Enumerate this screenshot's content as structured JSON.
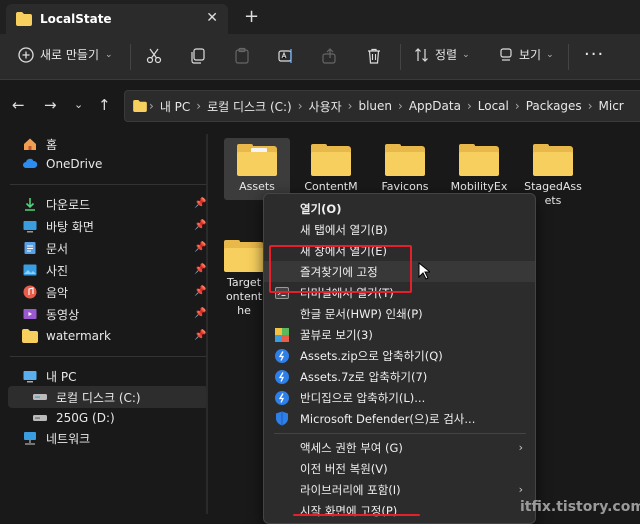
{
  "tab": {
    "title": "LocalState",
    "close": "✕",
    "new_tab": "+"
  },
  "toolbar": {
    "new_label": "새로 만들기",
    "sort_label": "정렬",
    "view_label": "보기",
    "more_label": "···"
  },
  "address": {
    "crumbs": [
      "내 PC",
      "로컬 디스크 (C:)",
      "사용자",
      "bluen",
      "AppData",
      "Local",
      "Packages",
      "Micr"
    ]
  },
  "sidebar": {
    "items": [
      {
        "label": "홈",
        "icon": "home-icon"
      },
      {
        "label": "OneDrive",
        "icon": "cloud-icon"
      },
      {
        "label": "다운로드",
        "icon": "download-icon"
      },
      {
        "label": "바탕 화면",
        "icon": "desktop-icon"
      },
      {
        "label": "문서",
        "icon": "document-icon"
      },
      {
        "label": "사진",
        "icon": "pictures-icon"
      },
      {
        "label": "음악",
        "icon": "music-icon"
      },
      {
        "label": "동영상",
        "icon": "video-icon"
      },
      {
        "label": "watermark",
        "icon": "folder-icon"
      },
      {
        "label": "내 PC",
        "icon": "pc-icon"
      },
      {
        "label": "로컬 디스크 (C:)",
        "icon": "drive-icon"
      },
      {
        "label": "250G (D:)",
        "icon": "drive-icon"
      },
      {
        "label": "네트워크",
        "icon": "network-icon"
      }
    ]
  },
  "folders": [
    {
      "name": "Assets"
    },
    {
      "name": "ContentM"
    },
    {
      "name": "Favicons"
    },
    {
      "name": "MobilityEx"
    },
    {
      "name": "StagedAss",
      "name2": "ets"
    },
    {
      "name": "Target",
      "name2": "ontent",
      "name3": "he"
    }
  ],
  "menu": {
    "items": [
      {
        "label": "열기(O)"
      },
      {
        "label": "새 탭에서 열기(B)"
      },
      {
        "label": "새 창에서 열기(E)"
      },
      {
        "label": "즐겨찾기에 고정"
      },
      {
        "label": "터미널에서 열기(T)"
      },
      {
        "label": "한글 문서(HWP) 인쇄(P)"
      },
      {
        "label": "꿀뷰로 보기(3)"
      },
      {
        "label": "Assets.zip으로 압축하기(Q)"
      },
      {
        "label": "Assets.7z로 압축하기(7)"
      },
      {
        "label": "반디집으로 압축하기(L)..."
      },
      {
        "label": "Microsoft Defender(으)로 검사..."
      },
      {
        "label": "액세스 권한 부여 (G)"
      },
      {
        "label": "이전 버전 복원(V)"
      },
      {
        "label": "라이브러리에 포함(I)"
      },
      {
        "label": "시작 화면에 고정(P)"
      }
    ]
  },
  "watermark": "itfix.tistory.com",
  "colors": {
    "accent": "#e5202a",
    "folder": "#f7cf5e",
    "background": "#191919"
  }
}
